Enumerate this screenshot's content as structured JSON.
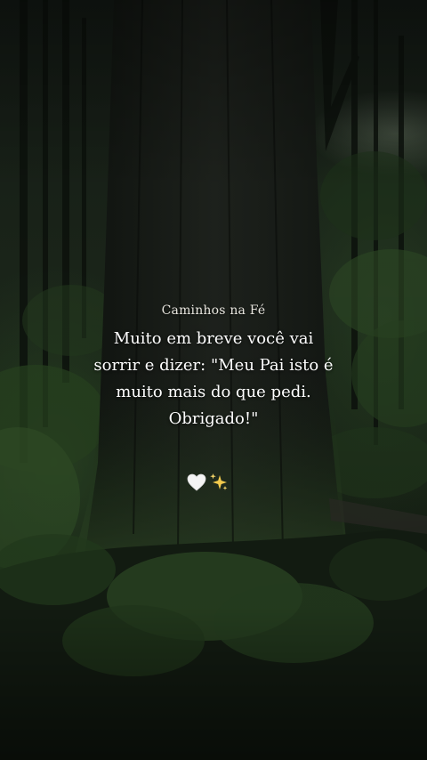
{
  "post": {
    "brand": "Caminhos na Fé",
    "quote": "Muito em breve você vai\nsorrir e dizer: \"Meu Pai isto é\nmuito mais do que pedi.\nObrigado!\""
  },
  "icons": [
    "white-heart-icon",
    "sparkles-icon"
  ],
  "colors": {
    "text": "#ffffff",
    "heart": "#f4f4f4",
    "sparkle": "#f2c94c"
  }
}
